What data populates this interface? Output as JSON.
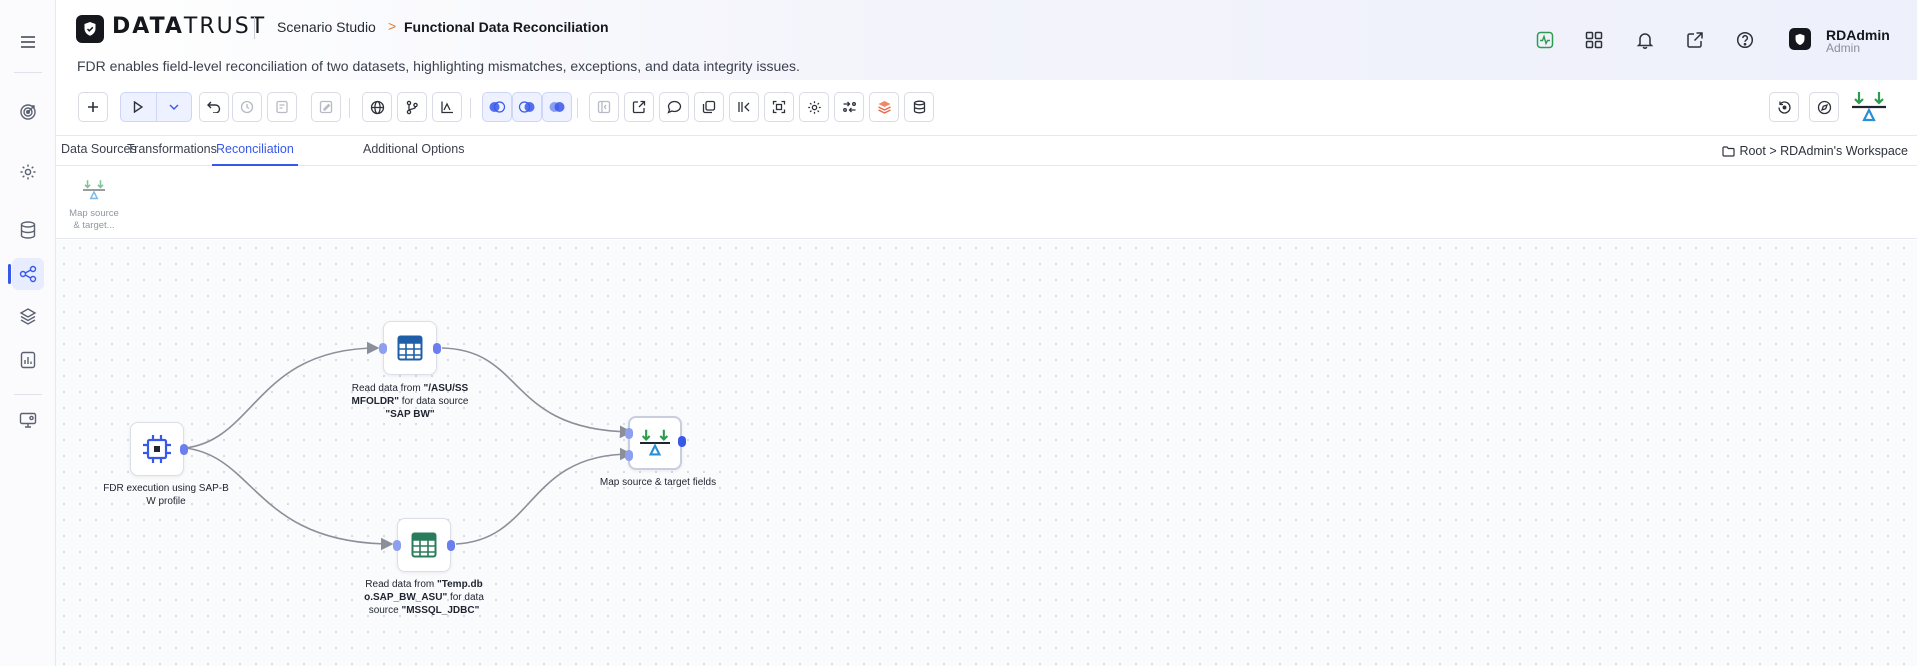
{
  "header": {
    "logo_bold": "DATA",
    "logo_light": "TRUST",
    "breadcrumb_parent": "Scenario Studio",
    "breadcrumb_separator": ">",
    "breadcrumb_current": "Functional Data Reconciliation",
    "description": "FDR enables field-level reconciliation of two datasets, highlighting mismatches, exceptions, and data integrity issues.",
    "icons": [
      "activity-icon",
      "apps-grid-icon",
      "bell-icon",
      "external-link-icon",
      "help-icon"
    ],
    "user": {
      "name": "RDAdmin",
      "role": "Admin"
    }
  },
  "sidebar": {
    "items": [
      {
        "name": "menu-icon"
      },
      {
        "name": "target-icon"
      },
      {
        "name": "settings-icon"
      },
      {
        "name": "database-icon"
      },
      {
        "name": "workflow-icon",
        "active": true
      },
      {
        "name": "layers-icon"
      },
      {
        "name": "report-icon"
      },
      {
        "name": "monitor-settings-icon"
      }
    ]
  },
  "toolbar": {
    "buttons": [
      "add",
      "run",
      "run-options",
      "undo",
      "history",
      "validate",
      "edit",
      "globe",
      "branch",
      "chart",
      "join-left",
      "join-inner",
      "join-right",
      "collapse",
      "export",
      "comment",
      "duplicate",
      "compare",
      "expand",
      "settings",
      "transform",
      "stack",
      "table-db"
    ],
    "right_buttons": [
      "restore",
      "compass",
      "reconcile-logo"
    ]
  },
  "tabs": {
    "items": [
      {
        "label": "Data Sources"
      },
      {
        "label": "Transformations"
      },
      {
        "label": "Reconciliation",
        "active": true
      },
      {
        "label": "Additional Options"
      }
    ],
    "workspace_path": "Root > RDAdmin's Workspace"
  },
  "components": {
    "map_label_1": "Map source",
    "map_label_2": "& target..."
  },
  "canvas": {
    "nodes": {
      "fdr": {
        "label_1": "FDR execution using SAP-B",
        "label_2": "W profile"
      },
      "sap": {
        "pre": "Read data from ",
        "path_1": "\"/ASU/SS",
        "path_2": "MFOLDR\"",
        "mid": " for data source",
        "source": "\"SAP BW\""
      },
      "mssql": {
        "pre": "Read data from ",
        "path_1": "\"Temp.db",
        "path_2": "o.SAP_BW_ASU\"",
        "mid": " for data",
        "mid_2": "source ",
        "source": "\"MSSQL_JDBC\""
      },
      "map": {
        "label": "Map source & target fields"
      }
    }
  },
  "colors": {
    "accent": "#3858e9",
    "port": "#8f9ff0",
    "reconcile_green": "#2e9c4f",
    "reconcile_blue": "#2b8fd6"
  }
}
